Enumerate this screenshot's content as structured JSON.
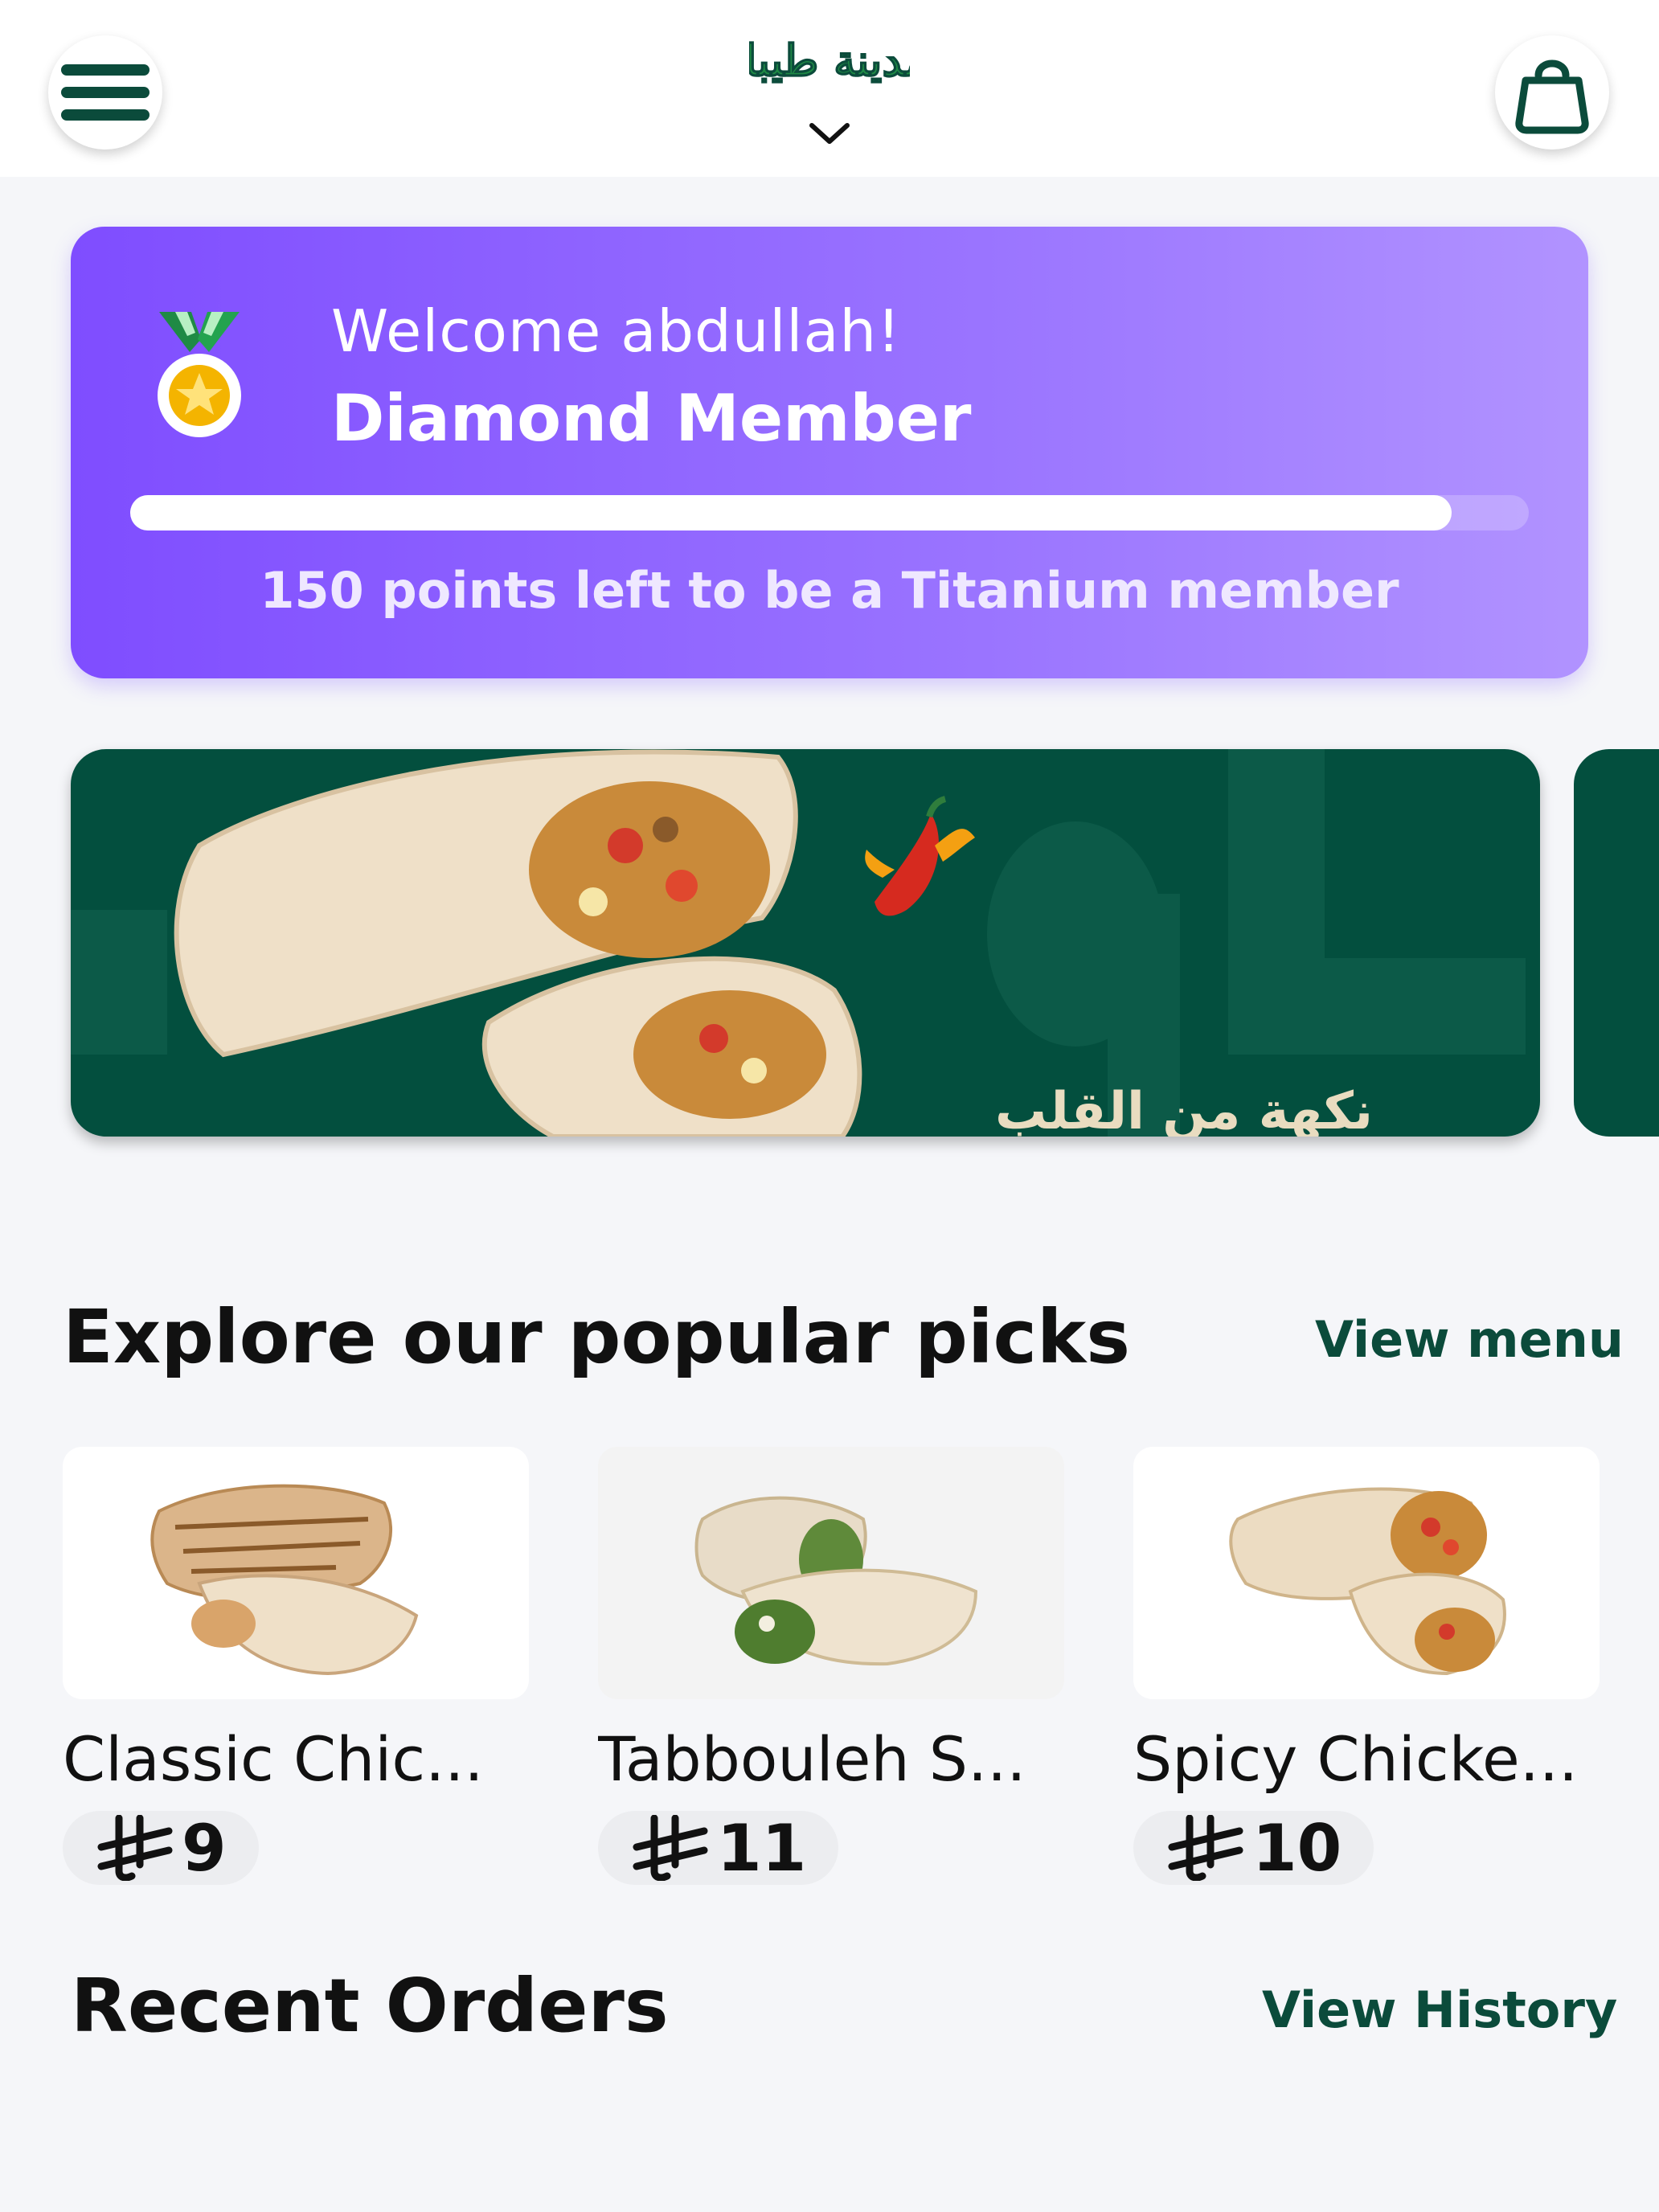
{
  "header": {
    "logo_text": "المدينة طيبات",
    "menu_icon": "hamburger-icon",
    "cart_icon": "shopping-bag-icon",
    "logo_dropdown_icon": "chevron-down-icon"
  },
  "loyalty": {
    "welcome": "Welcome abdullah!",
    "tier": "Diamond Member",
    "progress": 0.945,
    "points_left": "150 points left to be a Titanium member",
    "medal_icon": "medal-icon",
    "colors": {
      "start": "#7f4dff",
      "end": "#b193ff"
    }
  },
  "banner": {
    "arabic_text": "نكهة من القلب",
    "background": "#034f3e"
  },
  "popular": {
    "title": "Explore our popular picks",
    "link": "View menu",
    "items": [
      {
        "name": "Classic Chic...",
        "currency_icon": "riyal-icon",
        "price": "9"
      },
      {
        "name": "Tabbouleh S...",
        "currency_icon": "riyal-icon",
        "price": "11"
      },
      {
        "name": "Spicy Chicke...",
        "currency_icon": "riyal-icon",
        "price": "10"
      }
    ]
  },
  "recent": {
    "title": "Recent Orders",
    "link": "View History"
  },
  "colors": {
    "brand_green": "#0b4b3b",
    "background": "#f5f6f9"
  }
}
